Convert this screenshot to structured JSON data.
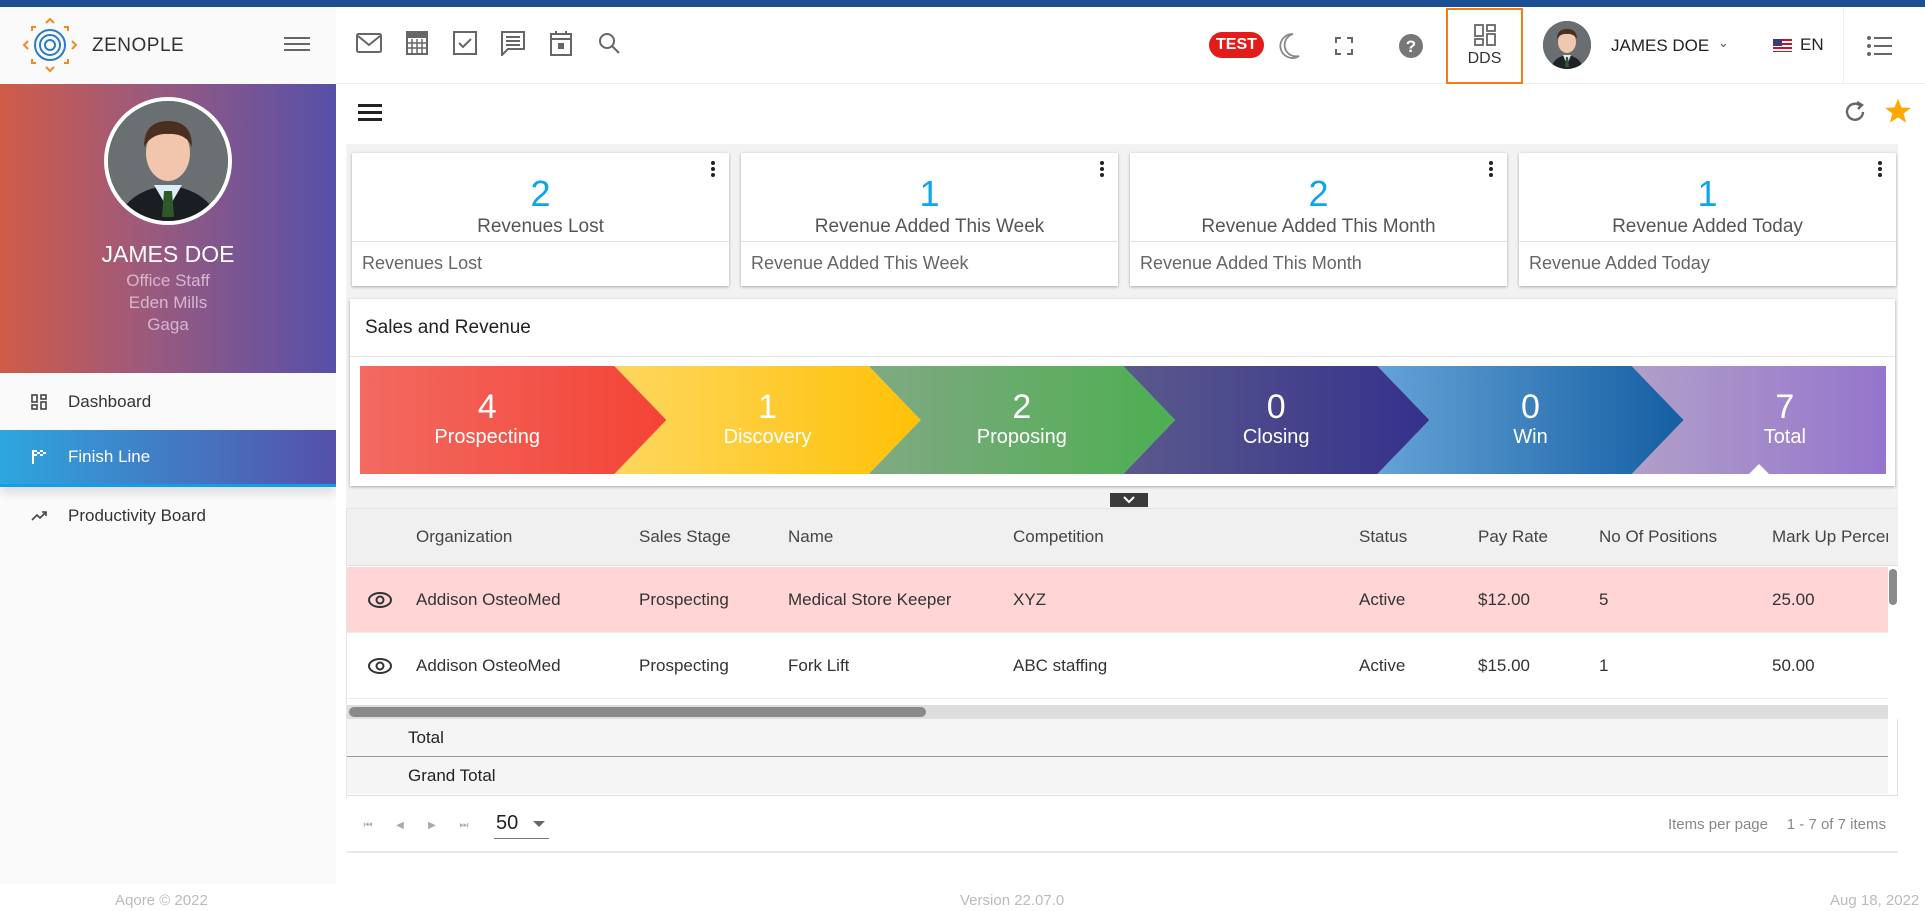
{
  "header": {
    "brand": "ZENOPLE",
    "tool_icons": [
      "mail-icon",
      "calculator-icon",
      "task-icon",
      "chat-icon",
      "calendar-icon",
      "search-icon"
    ],
    "env_badge": "TEST",
    "dds_label": "DDS",
    "user_name": "JAMES DOE",
    "language": "EN"
  },
  "sidebar": {
    "profile": {
      "name": "JAMES DOE",
      "role": "Office Staff",
      "location": "Eden Mills",
      "org": "Gaga"
    },
    "items": [
      {
        "label": "Dashboard",
        "icon": "dashboard-icon",
        "active": false
      },
      {
        "label": "Finish Line",
        "icon": "checkered-flag-icon",
        "active": true
      },
      {
        "label": "Productivity Board",
        "icon": "trending-up-icon",
        "active": false
      }
    ]
  },
  "cards": [
    {
      "value": "2",
      "title": "Revenues Lost",
      "subtitle": "Revenues Lost"
    },
    {
      "value": "1",
      "title": "Revenue Added This Week",
      "subtitle": "Revenue Added This Week"
    },
    {
      "value": "2",
      "title": "Revenue Added This Month",
      "subtitle": "Revenue Added This Month"
    },
    {
      "value": "1",
      "title": "Revenue Added Today",
      "subtitle": "Revenue Added Today"
    }
  ],
  "sales": {
    "title": "Sales and Revenue",
    "stages": [
      {
        "count": "4",
        "label": "Prospecting",
        "colors": [
          "#f26a60",
          "#f44336"
        ]
      },
      {
        "count": "1",
        "label": "Discovery",
        "colors": [
          "#fdd75e",
          "#ffc107"
        ]
      },
      {
        "count": "2",
        "label": "Proposing",
        "colors": [
          "#80a983",
          "#4caf50"
        ]
      },
      {
        "count": "0",
        "label": "Closing",
        "colors": [
          "#5a5a8c",
          "#35308c"
        ]
      },
      {
        "count": "0",
        "label": "Win",
        "colors": [
          "#64a3d6",
          "#145ea3"
        ]
      },
      {
        "count": "7",
        "label": "Total",
        "colors": [
          "#b19fc8",
          "#9575cd"
        ],
        "selected": true
      }
    ]
  },
  "grid": {
    "columns": [
      "",
      "Organization",
      "Sales Stage",
      "Name",
      "Competition",
      "Status",
      "Pay Rate",
      "No Of Positions",
      "Mark Up Percer"
    ],
    "rows": [
      {
        "organization": "Addison OsteoMed",
        "sales_stage": "Prospecting",
        "name": "Medical Store Keeper",
        "competition": "XYZ",
        "status": "Active",
        "pay_rate": "$12.00",
        "positions": "5",
        "markup": "25.00",
        "highlighted": true
      },
      {
        "organization": "Addison OsteoMed",
        "sales_stage": "Prospecting",
        "name": "Fork Lift",
        "competition": "ABC staffing",
        "status": "Active",
        "pay_rate": "$15.00",
        "positions": "1",
        "markup": "50.00",
        "highlighted": false
      }
    ],
    "total_label": "Total",
    "grand_total_label": "Grand Total",
    "pager": {
      "page_size": "50",
      "items_per_page_label": "Items per page",
      "range": "1 - 7 of 7 items"
    }
  },
  "footer": {
    "copyright": "Aqore © 2022",
    "version": "Version 22.07.0",
    "date": "Aug 18, 2022"
  }
}
